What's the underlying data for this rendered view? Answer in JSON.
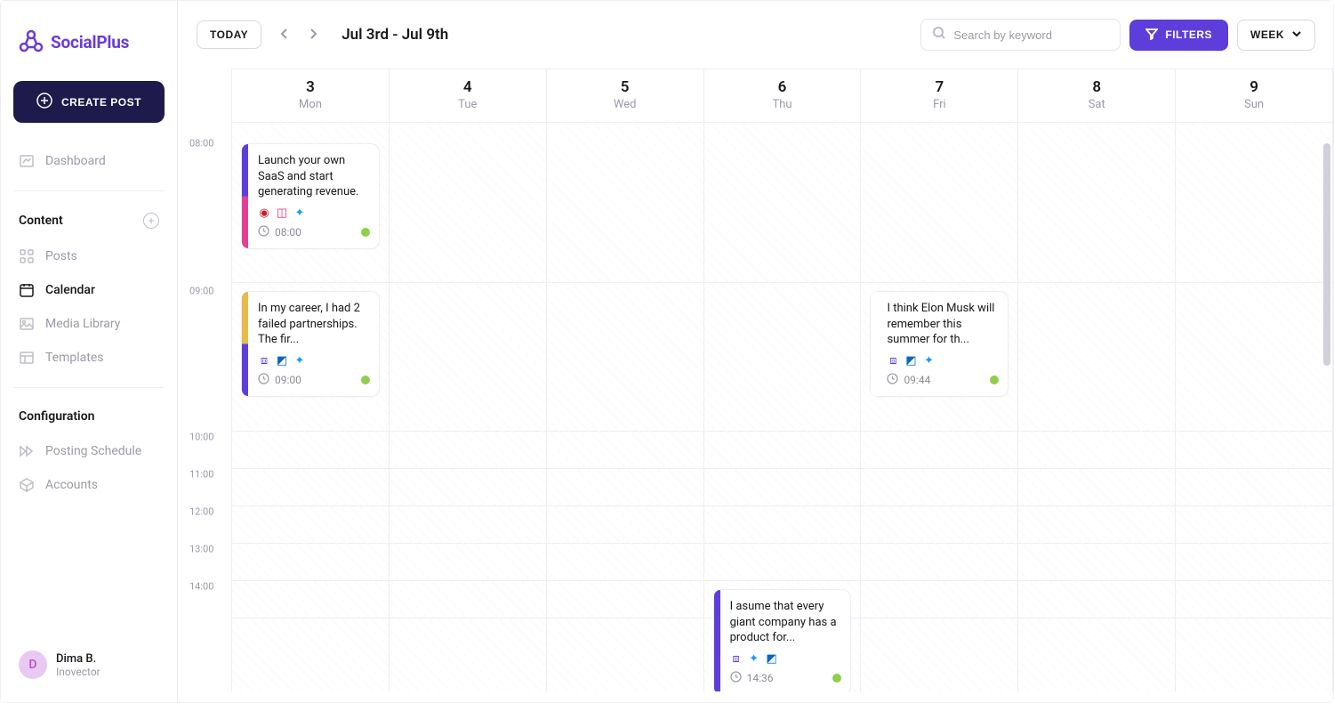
{
  "brand": "SocialPlus",
  "create_label": "CREATE POST",
  "sidebar": {
    "dashboard": "Dashboard",
    "content_header": "Content",
    "items": {
      "posts": "Posts",
      "calendar": "Calendar",
      "media": "Media Library",
      "templates": "Templates"
    },
    "config_header": "Configuration",
    "schedule": "Posting Schedule",
    "accounts": "Accounts"
  },
  "user": {
    "initial": "D",
    "name": "Dima B.",
    "org": "Inovector"
  },
  "topbar": {
    "today": "TODAY",
    "range": "Jul 3rd - Jul 9th",
    "search_placeholder": "Search by keyword",
    "filters": "FILTERS",
    "view": "WEEK"
  },
  "days": [
    {
      "num": "3",
      "name": "Mon"
    },
    {
      "num": "4",
      "name": "Tue"
    },
    {
      "num": "5",
      "name": "Wed"
    },
    {
      "num": "6",
      "name": "Thu"
    },
    {
      "num": "7",
      "name": "Fri"
    },
    {
      "num": "8",
      "name": "Sat"
    },
    {
      "num": "9",
      "name": "Sun"
    }
  ],
  "hours": [
    "08:00",
    "09:00",
    "10:00",
    "11:00",
    "12:00",
    "13:00",
    "14:00"
  ],
  "events": {
    "e1": {
      "text": "Launch your own SaaS and start generating revenue.",
      "time": "08:00"
    },
    "e2": {
      "text": "In my career, I had 2 failed partnerships. The fir...",
      "time": "09:00"
    },
    "e3": {
      "text": "I think Elon Musk will remember this summer for th...",
      "time": "09:44"
    },
    "e4": {
      "text": "I asume that every giant company has a product for...",
      "time": "14:36"
    }
  }
}
